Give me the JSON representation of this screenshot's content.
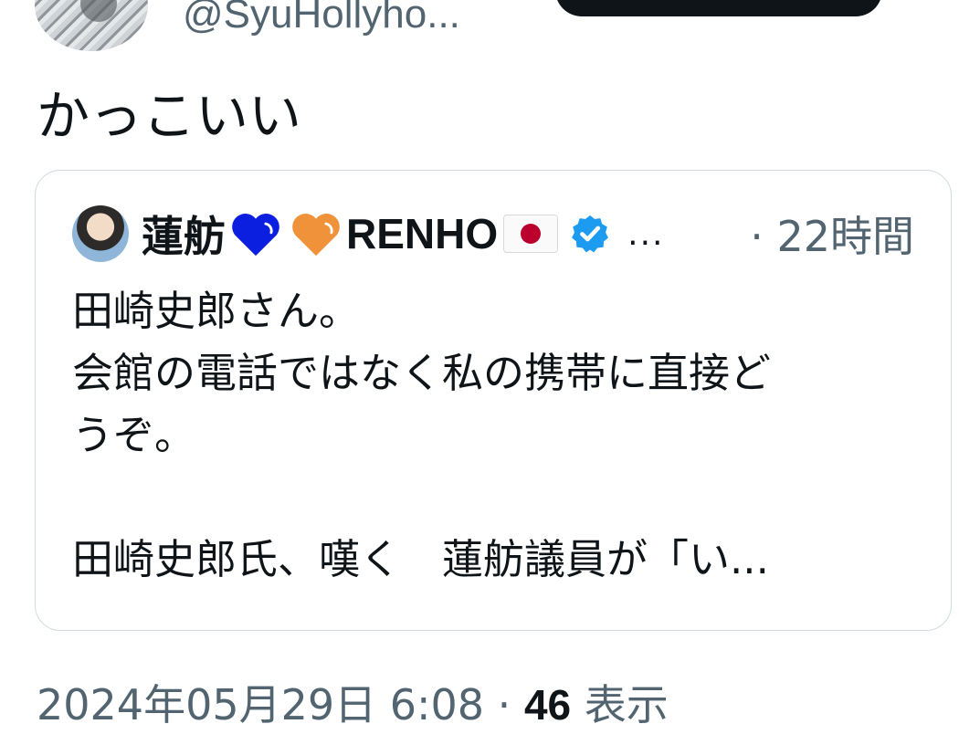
{
  "top": {
    "handle": "@SyuHollyho..."
  },
  "tweet": {
    "text": "かっこいい"
  },
  "quote": {
    "name_prefix": "蓮舫",
    "name_latin": "RENHO",
    "ellipsis": "...",
    "time": "· 22時間",
    "lines": [
      "田崎史郎さん。",
      "会館の電話ではなく私の携帯に直接ど",
      "うぞ。",
      "",
      "田崎史郎氏、嘆く　蓮舫議員が「い..."
    ],
    "heart_colors": [
      "#0a1fe0",
      "#f0923a"
    ],
    "verified_color": "#1d9bf0"
  },
  "meta": {
    "datetime": "2024年05月29日 6:08",
    "separator": " · ",
    "views_count": "46",
    "views_label": " 表示"
  }
}
